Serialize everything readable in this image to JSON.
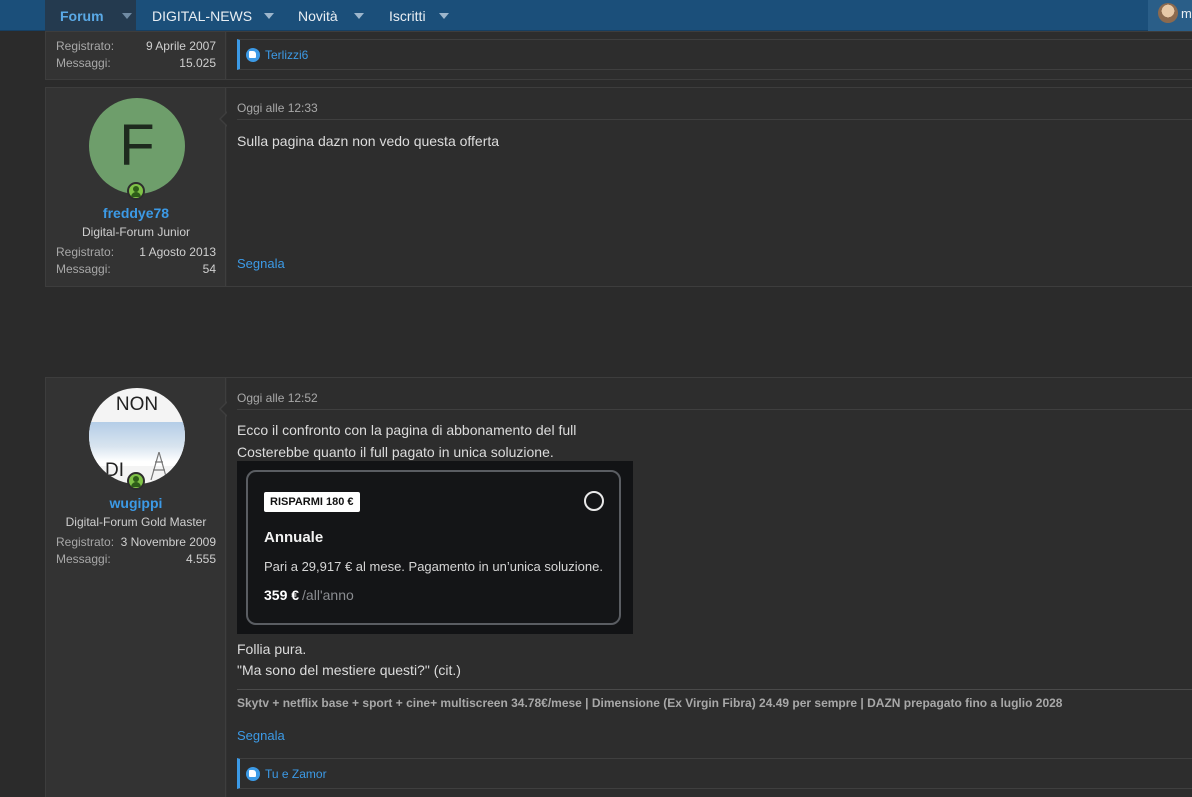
{
  "nav": {
    "tabs": [
      {
        "label": "Forum",
        "active": true
      },
      {
        "label": "DIGITAL-NEWS"
      },
      {
        "label": "Novità"
      },
      {
        "label": "Iscritti"
      }
    ],
    "user_initial": "m"
  },
  "post0": {
    "registered_label": "Registrato:",
    "registered_value": "9 Aprile 2007",
    "messages_label": "Messaggi:",
    "messages_value": "15.025",
    "reactions": "Terlizzi6"
  },
  "post1": {
    "avatar_letter": "F",
    "avatar_color": "#6e9e6b",
    "username": "freddye78",
    "title": "Digital-Forum Junior",
    "registered_label": "Registrato:",
    "registered_value": "1 Agosto 2013",
    "messages_label": "Messaggi:",
    "messages_value": "54",
    "date": "Oggi alle 12:33",
    "text": "Sulla pagina dazn non vedo questa offerta",
    "report": "Segnala"
  },
  "post2": {
    "avatar_text_top": "NON",
    "avatar_text_bottom": "DI",
    "username": "wugippi",
    "title": "Digital-Forum Gold Master",
    "registered_label": "Registrato:",
    "registered_value": "3 Novembre 2009",
    "messages_label": "Messaggi:",
    "messages_value": "4.555",
    "date": "Oggi alle 12:52",
    "text_line1": "Ecco il confronto con la pagina di abbonamento del full",
    "text_line2": "Costerebbe quanto il full pagato in unica soluzione.",
    "embed": {
      "badge": "RISPARMI 180 €",
      "title": "Annuale",
      "description": "Pari a 29,917 € al mese. Pagamento in un’unica soluzione.",
      "price": "359 €",
      "period": "/all'anno"
    },
    "text_line3": "Follia pura.",
    "text_line4": "\"Ma sono del mestiere questi?\" (cit.)",
    "signature": "Skytv + netflix base + sport + cine+ multiscreen 34.78€/mese | Dimensione (Ex Virgin Fibra) 24.49 per sempre | DAZN prepagato fino a luglio 2028",
    "report": "Segnala",
    "reactions": "Tu e Zamor"
  }
}
